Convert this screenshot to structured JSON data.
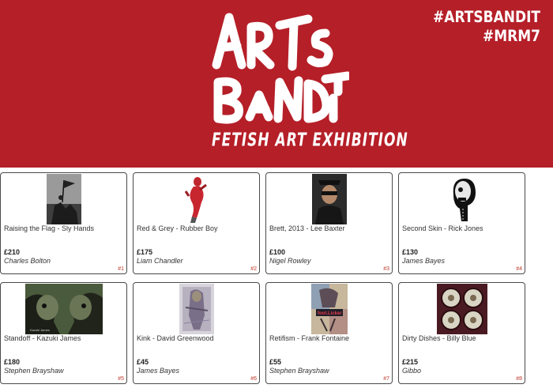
{
  "banner": {
    "logo_text": "ARTS BANDIT",
    "tagline": "FETISH ART EXHIBITION",
    "hashtag_1": "#ARTSBANDIT",
    "hashtag_2": "#MRM7",
    "color": "#b51f28"
  },
  "cards": [
    {
      "title": "Raising the Flag - Sly Hands",
      "price": "£210",
      "buyer": "Charles Bolton",
      "num": "#1"
    },
    {
      "title": "Red & Grey - Rubber Boy",
      "price": "£175",
      "buyer": "Liam Chandler",
      "num": "#2"
    },
    {
      "title": "Brett, 2013 - Lee Baxter",
      "price": "£100",
      "buyer": "Nigel Rowley",
      "num": "#3"
    },
    {
      "title": "Second Skin - Rick Jones",
      "price": "£130",
      "buyer": "James Bayes",
      "num": "#4"
    },
    {
      "title": "Standoff - Kazuki James",
      "price": "£180",
      "buyer": "Stephen Brayshaw",
      "num": "#5"
    },
    {
      "title": "Kink - David Greenwood",
      "price": "£45",
      "buyer": "James Bayes",
      "num": "#6"
    },
    {
      "title": "Retifism - Frank Fontaine",
      "price": "£55",
      "buyer": "Stephen Brayshaw",
      "num": "#7"
    },
    {
      "title": "Dirty Dishes - Billy Blue",
      "price": "£215",
      "buyer": "Gibbo",
      "num": "#8"
    }
  ],
  "thumb_lettering": {
    "standoff": "Kazuki James",
    "retifism": "foot.Licker"
  }
}
